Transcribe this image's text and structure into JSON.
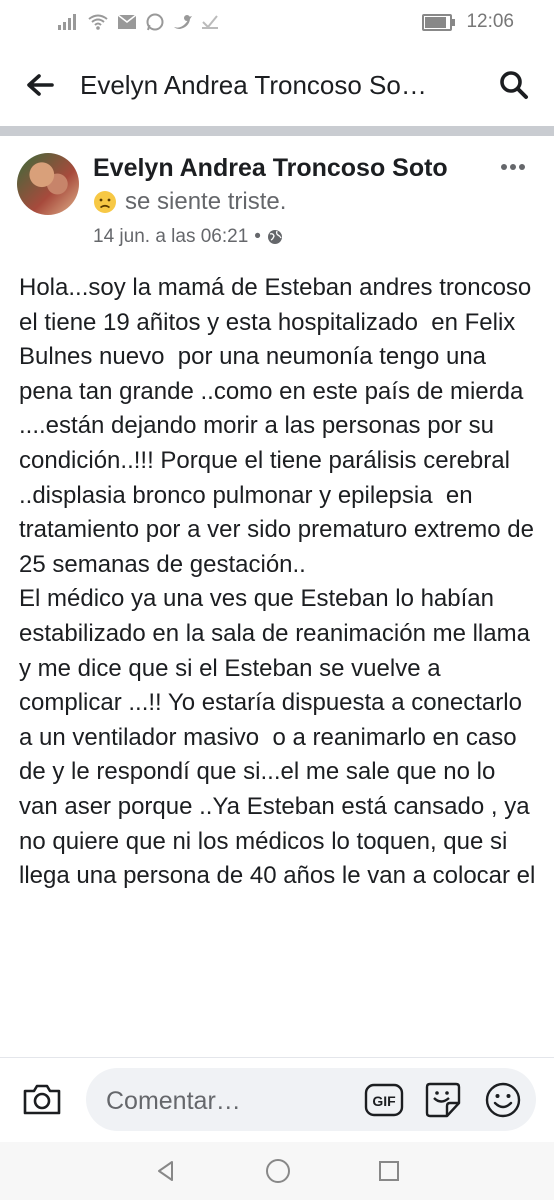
{
  "status_bar": {
    "time": "12:06",
    "battery_fraction": 0.8,
    "icons": [
      "signal-icon",
      "wifi-icon",
      "mail-icon",
      "whatsapp-icon",
      "twitter-icon",
      "check-icon",
      "battery-icon"
    ]
  },
  "header": {
    "title": "Evelyn Andrea Troncoso So…",
    "back_icon": "arrow-left-icon",
    "search_icon": "search-icon"
  },
  "post": {
    "author": "Evelyn Andrea Troncoso Soto",
    "feeling_emoji": "sad-face-icon",
    "feeling": "se siente triste.",
    "date": "14 jun. a las 06:21",
    "separator": "•",
    "privacy_icon": "globe-icon",
    "more_icon": "more-dots-icon",
    "body": "Hola...soy la mamá de Esteban andres troncoso  el tiene 19 añitos y esta hospitalizado  en Felix Bulnes nuevo  por una neumonía tengo una pena tan grande ..como en este país de mierda ....están dejando morir a las personas por su condición..!!! Porque el tiene parálisis cerebral ..displasia bronco pulmonar y epilepsia  en tratamiento por a ver sido prematuro extremo de 25 semanas de gestación..\nEl médico ya una ves que Esteban lo habían estabilizado en la sala de reanimación me llama y me dice que si el Esteban se vuelve a complicar ...!! Yo estaría dispuesta a conectarlo a un ventilador masivo  o a reanimarlo en caso de y le respondí que si...el me sale que no lo van aser porque ..Ya Esteban está cansado , ya no quiere que ni los médicos lo toquen, que si llega una persona de 40 años le van a colocar el"
  },
  "composer": {
    "placeholder": "Comentar…",
    "camera_icon": "camera-icon",
    "gif_label": "GIF",
    "sticker_icon": "sticker-icon",
    "emoji_icon": "smiley-icon"
  },
  "nav": {
    "icons": [
      "back-triangle-icon",
      "home-circle-icon",
      "recents-square-icon"
    ]
  }
}
